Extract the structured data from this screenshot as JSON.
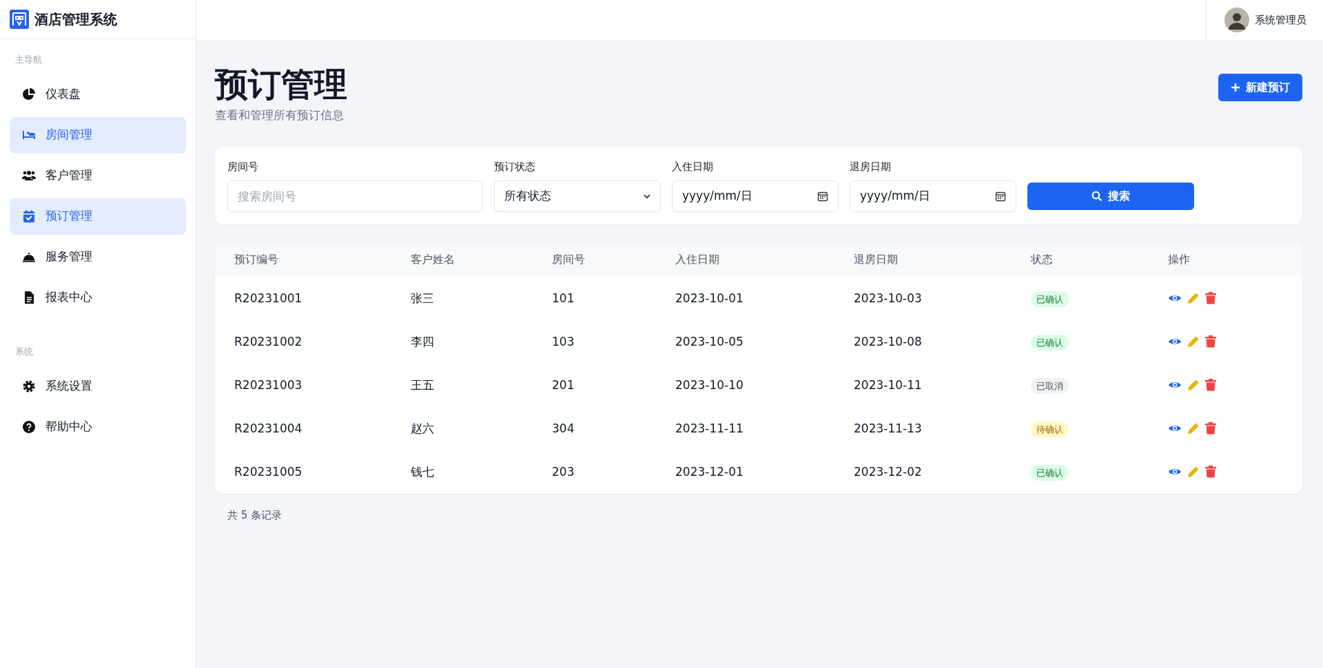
{
  "app": {
    "title": "酒店管理系统"
  },
  "user": {
    "name": "系统管理员"
  },
  "sidebar": {
    "sections": [
      {
        "label": "主导航",
        "items": [
          {
            "label": "仪表盘",
            "kind": "pie",
            "selected": false
          },
          {
            "label": "房间管理",
            "kind": "bed",
            "selected": true
          },
          {
            "label": "客户管理",
            "kind": "users",
            "selected": false
          },
          {
            "label": "预订管理",
            "kind": "calendar",
            "selected": true
          },
          {
            "label": "服务管理",
            "kind": "bell",
            "selected": false
          },
          {
            "label": "报表中心",
            "kind": "file",
            "selected": false
          }
        ]
      },
      {
        "label": "系统",
        "items": [
          {
            "label": "系统设置",
            "kind": "gear",
            "selected": false
          },
          {
            "label": "帮助中心",
            "kind": "help",
            "selected": false
          }
        ]
      }
    ]
  },
  "page": {
    "title": "预订管理",
    "subtitle": "查看和管理所有预订信息",
    "new_button": "新建预订"
  },
  "filters": {
    "room": {
      "label": "房间号",
      "placeholder": "搜索房间号"
    },
    "status": {
      "label": "预订状态",
      "value": "所有状态"
    },
    "checkin": {
      "label": "入住日期",
      "value": "yyyy/mm/日"
    },
    "checkout": {
      "label": "退房日期",
      "value": "yyyy/mm/日"
    },
    "search_button": "搜索"
  },
  "table": {
    "columns": [
      "预订编号",
      "客户姓名",
      "房间号",
      "入住日期",
      "退房日期",
      "状态",
      "操作"
    ],
    "rows": [
      {
        "id": "R20231001",
        "customer": "张三",
        "room": "101",
        "checkin": "2023-10-01",
        "checkout": "2023-10-03",
        "status": {
          "text": "已确认",
          "kind": "confirmed"
        }
      },
      {
        "id": "R20231002",
        "customer": "李四",
        "room": "103",
        "checkin": "2023-10-05",
        "checkout": "2023-10-08",
        "status": {
          "text": "已确认",
          "kind": "confirmed"
        }
      },
      {
        "id": "R20231003",
        "customer": "王五",
        "room": "201",
        "checkin": "2023-10-10",
        "checkout": "2023-10-11",
        "status": {
          "text": "已取消",
          "kind": "cancelled"
        }
      },
      {
        "id": "R20231004",
        "customer": "赵六",
        "room": "304",
        "checkin": "2023-11-11",
        "checkout": "2023-11-13",
        "status": {
          "text": "待确认",
          "kind": "pending"
        }
      },
      {
        "id": "R20231005",
        "customer": "钱七",
        "room": "203",
        "checkin": "2023-12-01",
        "checkout": "2023-12-02",
        "status": {
          "text": "已确认",
          "kind": "confirmed"
        }
      }
    ]
  },
  "footer": {
    "count": "共 5 条记录"
  }
}
